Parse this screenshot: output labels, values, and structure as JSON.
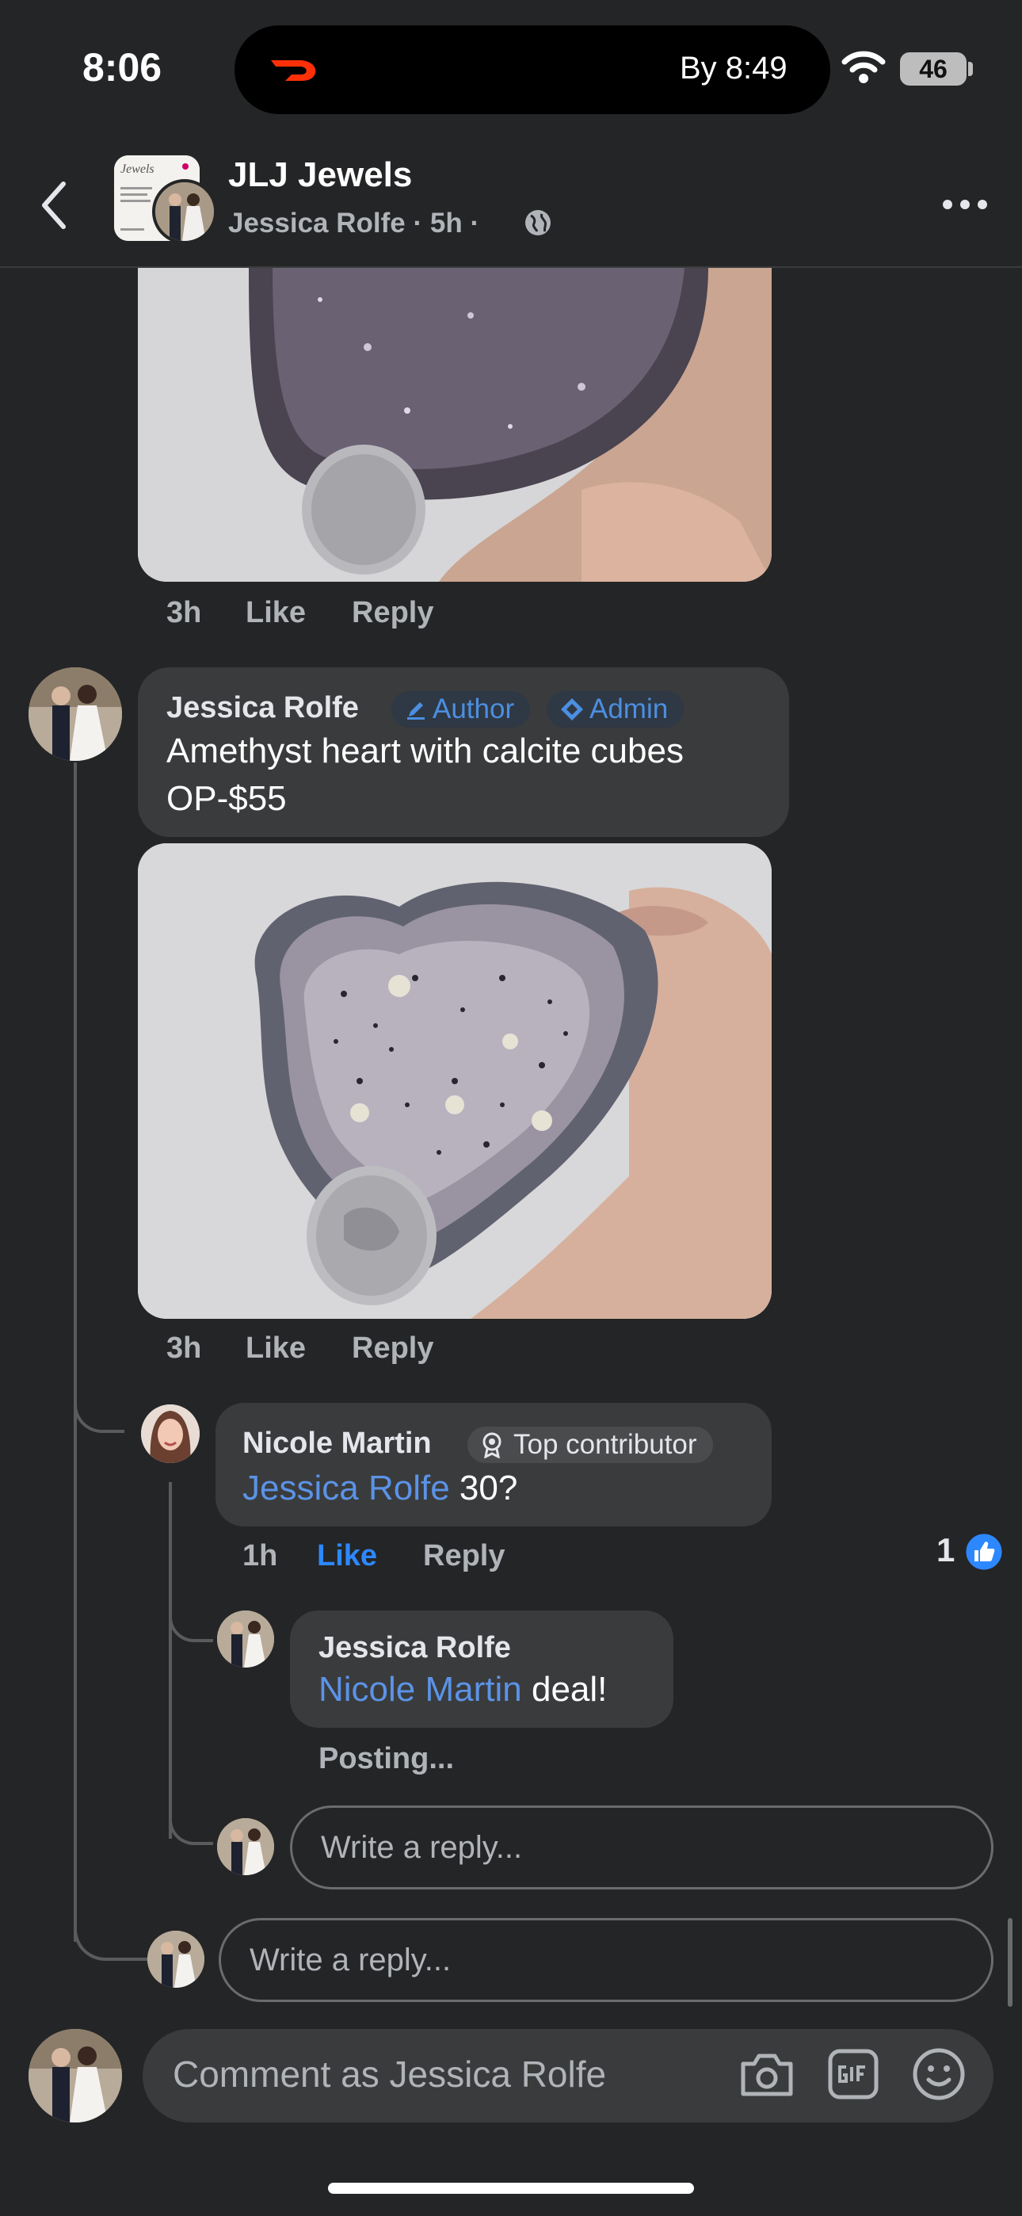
{
  "status_bar": {
    "time": "8:06",
    "live_activity": "By 8:49",
    "battery": "46"
  },
  "header": {
    "group_name": "JLJ Jewels",
    "author": "Jessica Rolfe",
    "age": "5h",
    "separator": "·"
  },
  "comments": [
    {
      "time": "3h",
      "like": "Like",
      "reply": "Reply"
    },
    {
      "author": "Jessica Rolfe",
      "badges": [
        "Author",
        "Admin"
      ],
      "text_line1": "Amethyst heart with calcite cubes",
      "text_line2": "OP-$55",
      "time": "3h",
      "like": "Like",
      "reply": "Reply"
    }
  ],
  "replies": [
    {
      "author": "Nicole Martin",
      "badge": "Top contributor",
      "mention": "Jessica Rolfe",
      "text": " 30?",
      "time": "1h",
      "like": "Like",
      "reply": "Reply",
      "reaction_count": "1"
    },
    {
      "author": "Jessica Rolfe",
      "mention": "Nicole Martin",
      "text": " deal!",
      "status": "Posting..."
    }
  ],
  "reply_placeholder_nested": "Write a reply...",
  "reply_placeholder_thread": "Write a reply...",
  "composer_placeholder": "Comment as Jessica Rolfe",
  "colors": {
    "background": "#242526",
    "bubble": "#3a3b3c",
    "link": "#5b93e6",
    "like_active": "#2d88ff"
  }
}
